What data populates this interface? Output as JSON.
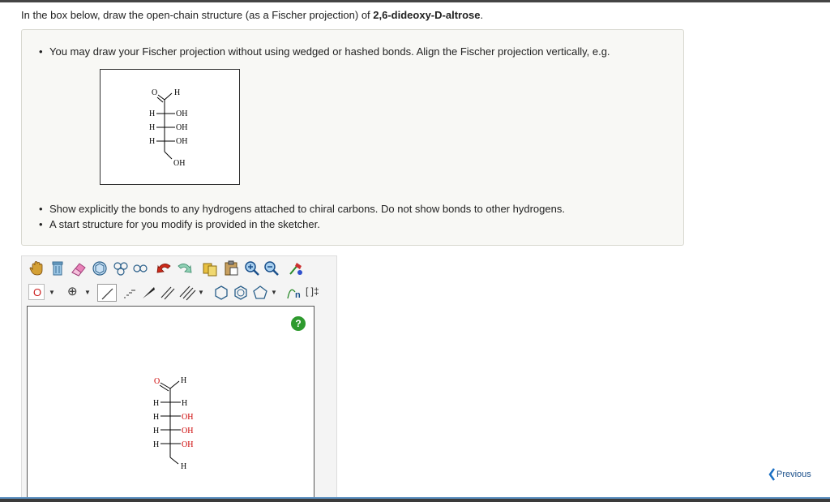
{
  "question": {
    "prefix": "In the box below, draw the open-chain structure (as a Fischer projection) of ",
    "compound": "2,6-dideoxy-D-altrose",
    "suffix": "."
  },
  "instructions": {
    "bullet1": "You may draw your Fischer projection without using wedged or hashed bonds. Align the Fischer projection vertically, e.g.",
    "bullet2": "Show explicitly the bonds to any hydrogens attached to chiral carbons. Do not show bonds to other hydrogens.",
    "bullet3": "A start structure for you modify is provided in the sketcher."
  },
  "example_structure": {
    "top_O": "O",
    "top_H": "H",
    "rows": [
      {
        "left": "H",
        "right": "OH"
      },
      {
        "left": "H",
        "right": "OH"
      },
      {
        "left": "H",
        "right": "OH"
      }
    ],
    "bottom": "OH"
  },
  "sketcher": {
    "toolbar_row1": [
      "hand-icon",
      "erase-all-icon",
      "eraser-icon",
      "ring-template-icon",
      "templates-icon",
      "chain-icon",
      "undo-icon",
      "redo-icon",
      "copy-icon",
      "paste-icon",
      "zoom-in-icon",
      "zoom-out-icon",
      "clean-icon"
    ],
    "element_selected": "O",
    "charge_symbol": "⊕",
    "sgroup_label": "n",
    "bracket_label": "[ ]‡",
    "help_label": "?",
    "start_structure": {
      "top_O": "O",
      "top_H": "H",
      "rows": [
        {
          "left": "H",
          "right": "H"
        },
        {
          "left": "H",
          "right": "OH"
        },
        {
          "left": "H",
          "right": "OH"
        },
        {
          "left": "H",
          "right": "OH"
        }
      ],
      "bottom": "H"
    },
    "colors": {
      "oxygen": "#cc0000",
      "bond": "#000000"
    }
  },
  "nav": {
    "previous_label": "Previous"
  }
}
